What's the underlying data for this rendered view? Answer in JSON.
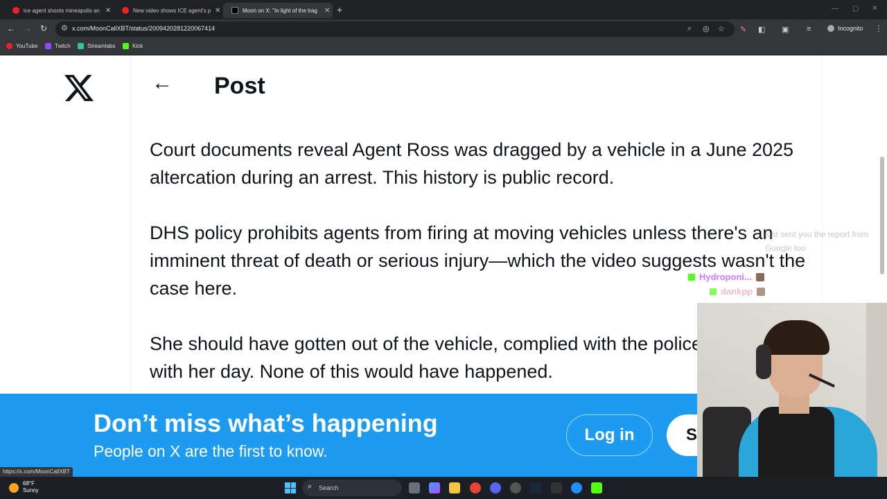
{
  "browser": {
    "tabs": [
      {
        "title": "ice agent shoots mineapolis an",
        "icon": "youtube-icon"
      },
      {
        "title": "New video shows ICE agent's p",
        "icon": "youtube-icon"
      },
      {
        "title": "Moon on X: \"In light of the trag",
        "icon": "x-icon",
        "active": true
      }
    ],
    "url": "x.com/MoonCallXBT/status/2009420281220067414",
    "profile": "Incognito",
    "bookmarks": [
      "YouTube",
      "Twitch",
      "Streamlabs",
      "Kick"
    ]
  },
  "page": {
    "header_title": "Post",
    "paragraphs": [
      "Court documents reveal Agent Ross was dragged by a vehicle in a June 2025 altercation during an arrest. This history is public record.",
      "DHS policy prohibits agents from firing at moving vehicles unless there's an imminent threat of death or serious injury—which the video suggests wasn't the case here.",
      "She should have gotten out of the vehicle, complied with the police, moved on with her day. None of this would have happened."
    ]
  },
  "banner": {
    "title": "Don’t miss what’s happening",
    "subtitle": "People on X are the first to know.",
    "login": "Log in",
    "signup": "S"
  },
  "chat": {
    "users": [
      "Hydroponi...",
      "dankpp"
    ],
    "message": "just sent you the report from Google too"
  },
  "status_url": "https://x.com/MoonCallXBT",
  "taskbar": {
    "temperature": "68°F",
    "condition": "Sunny",
    "search_label": "Search"
  },
  "colors": {
    "x_blue": "#1d9bf0",
    "kick_green": "#53fc18",
    "chat_user_color": "#c77dff"
  }
}
